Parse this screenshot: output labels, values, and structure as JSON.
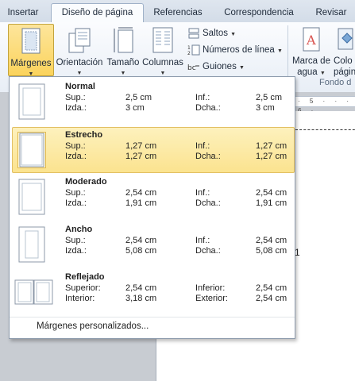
{
  "tabs": [
    "Insertar",
    "Diseño de página",
    "Referencias",
    "Correspondencia",
    "Revisar"
  ],
  "ribbon": {
    "margins_label": "Márgenes",
    "orientation_label": "Orientación",
    "size_label": "Tamaño",
    "columns_label": "Columnas",
    "breaks_label": "Saltos",
    "line_numbers_label": "Números de línea",
    "hyphenation_label": "Guiones",
    "watermark_label_1": "Marca de",
    "watermark_label_2": "agua",
    "page_color_label_1": "Colo",
    "page_color_label_2": "págin",
    "page_background_group": "Fondo d"
  },
  "ruler_text": "· 5 · · · 6 ·",
  "doc_cursor_text": "1",
  "margins_menu": {
    "options": [
      {
        "name": "Normal",
        "rows": [
          [
            "Sup.:",
            "2,5 cm",
            "Inf.:",
            "2,5 cm"
          ],
          [
            "Izda.:",
            "3 cm",
            "Dcha.:",
            "3 cm"
          ]
        ]
      },
      {
        "name": "Estrecho",
        "rows": [
          [
            "Sup.:",
            "1,27 cm",
            "Inf.:",
            "1,27 cm"
          ],
          [
            "Izda.:",
            "1,27 cm",
            "Dcha.:",
            "1,27 cm"
          ]
        ]
      },
      {
        "name": "Moderado",
        "rows": [
          [
            "Sup.:",
            "2,54 cm",
            "Inf.:",
            "2,54 cm"
          ],
          [
            "Izda.:",
            "1,91 cm",
            "Dcha.:",
            "1,91 cm"
          ]
        ]
      },
      {
        "name": "Ancho",
        "rows": [
          [
            "Sup.:",
            "2,54 cm",
            "Inf.:",
            "2,54 cm"
          ],
          [
            "Izda.:",
            "5,08 cm",
            "Dcha.:",
            "5,08 cm"
          ]
        ]
      },
      {
        "name": "Reflejado",
        "rows": [
          [
            "Superior:",
            "2,54 cm",
            "Inferior:",
            "2,54 cm"
          ],
          [
            "Interior:",
            "3,18 cm",
            "Exterior:",
            "2,54 cm"
          ]
        ]
      }
    ],
    "custom_label": "Márgenes personalizados..."
  }
}
